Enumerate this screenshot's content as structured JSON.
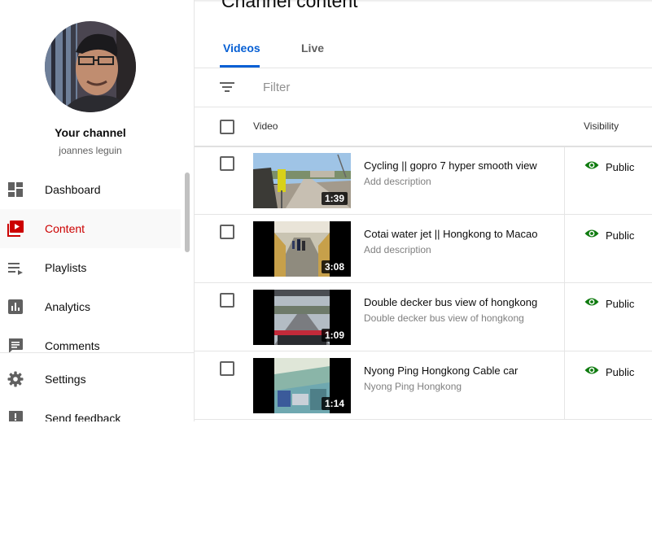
{
  "header": {
    "title": "Channel content"
  },
  "sidebar": {
    "channel_title": "Your channel",
    "channel_name": "joannes leguin",
    "items": [
      {
        "label": "Dashboard",
        "icon": "dashboard-icon"
      },
      {
        "label": "Content",
        "icon": "content-icon",
        "active": true
      },
      {
        "label": "Playlists",
        "icon": "playlists-icon"
      },
      {
        "label": "Analytics",
        "icon": "analytics-icon"
      },
      {
        "label": "Comments",
        "icon": "comments-icon"
      },
      {
        "label": "Settings",
        "icon": "gear-icon"
      },
      {
        "label": "Send feedback",
        "icon": "feedback-icon"
      }
    ]
  },
  "tabs": [
    {
      "label": "Videos",
      "active": true
    },
    {
      "label": "Live",
      "active": false
    }
  ],
  "filter": {
    "placeholder": "Filter"
  },
  "table": {
    "columns": {
      "video": "Video",
      "visibility": "Visibility"
    },
    "rows": [
      {
        "title": "Cycling || gopro 7 hyper smooth view",
        "description": "Add description",
        "duration": "1:39",
        "visibility": "Public"
      },
      {
        "title": "Cotai water jet || Hongkong to Macao",
        "description": "Add description",
        "duration": "3:08",
        "visibility": "Public"
      },
      {
        "title": "Double decker bus view of hongkong",
        "description": "Double decker bus view of hongkong",
        "duration": "1:09",
        "visibility": "Public"
      },
      {
        "title": "Nyong Ping Hongkong Cable car",
        "description": "Nyong Ping Hongkong",
        "duration": "1:14",
        "visibility": "Public"
      }
    ]
  },
  "colors": {
    "accent": "#065fd4",
    "active_red": "#cc0000",
    "public_green": "#0f7b0f"
  }
}
